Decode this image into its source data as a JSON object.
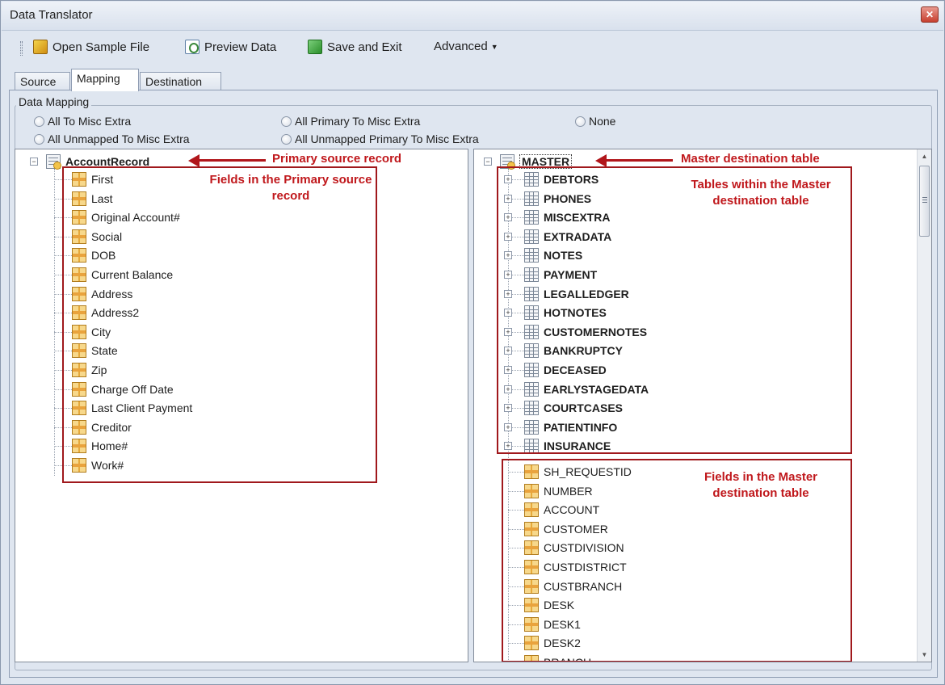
{
  "window": {
    "title": "Data Translator"
  },
  "toolbar": {
    "open_sample_file": "Open Sample File",
    "preview_data": "Preview Data",
    "save_and_exit": "Save and Exit",
    "advanced": "Advanced"
  },
  "tabs": [
    {
      "label": "Source",
      "active": false
    },
    {
      "label": "Mapping",
      "active": true
    },
    {
      "label": "Destination",
      "active": false
    }
  ],
  "data_mapping": {
    "legend": "Data Mapping",
    "options": [
      "All To Misc Extra",
      "All Unmapped To Misc Extra",
      "All Primary To Misc Extra",
      "All Unmapped Primary To Misc Extra",
      "None"
    ]
  },
  "source_tree": {
    "root": "AccountRecord",
    "fields": [
      "First",
      "Last",
      "Original Account#",
      "Social",
      "DOB",
      "Current Balance",
      "Address",
      "Address2",
      "City",
      "State",
      "Zip",
      "Charge Off Date",
      "Last Client Payment",
      "Creditor",
      "Home#",
      "Work#"
    ]
  },
  "dest_tree": {
    "root": "MASTER",
    "tables": [
      "DEBTORS",
      "PHONES",
      "MISCEXTRA",
      "EXTRADATA",
      "NOTES",
      "PAYMENT",
      "LEGALLEDGER",
      "HOTNOTES",
      "CUSTOMERNOTES",
      "BANKRUPTCY",
      "DECEASED",
      "EARLYSTAGEDATA",
      "COURTCASES",
      "PATIENTINFO",
      "INSURANCE"
    ],
    "fields": [
      "SH_REQUESTID",
      "NUMBER",
      "ACCOUNT",
      "CUSTOMER",
      "CUSTDIVISION",
      "CUSTDISTRICT",
      "CUSTBRANCH",
      "DESK",
      "DESK1",
      "DESK2",
      "BRANCH"
    ]
  },
  "annotations": {
    "primary_source": "Primary source record",
    "fields_primary": "Fields in the Primary source record",
    "master_dest": "Master destination table",
    "tables_within": "Tables within the Master destination table",
    "fields_master": "Fields in the Master destination table"
  },
  "colors": {
    "annotation_red": "#c0181c",
    "window_bg": "#dfe6f0"
  }
}
